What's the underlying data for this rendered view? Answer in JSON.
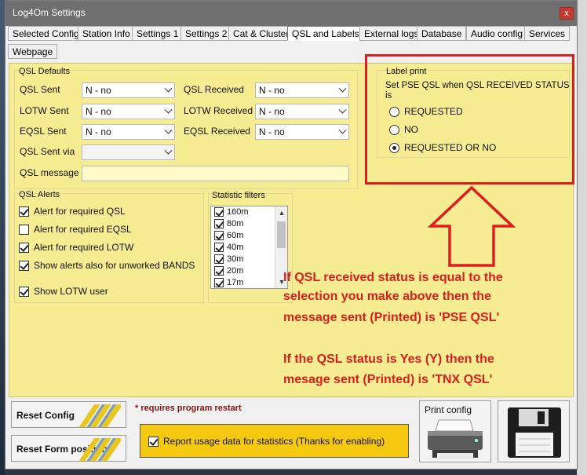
{
  "window": {
    "title": "Log4Om Settings",
    "close_glyph": "x"
  },
  "tabs": [
    {
      "label": "Selected Config"
    },
    {
      "label": "Station Info"
    },
    {
      "label": "Settings 1"
    },
    {
      "label": "Settings 2"
    },
    {
      "label": "Cat & Cluster"
    },
    {
      "label": "QSL and Labels",
      "active": true
    },
    {
      "label": "External logs"
    },
    {
      "label": "Database"
    },
    {
      "label": "Audio config"
    },
    {
      "label": "Services"
    },
    {
      "label": "Webpage"
    }
  ],
  "qsl_defaults": {
    "group_label": "QSL Defaults",
    "qsl_sent_label": "QSL Sent",
    "qsl_sent_value": "N - no",
    "qsl_received_label": "QSL Received",
    "qsl_received_value": "N - no",
    "lotw_sent_label": "LOTW Sent",
    "lotw_sent_value": "N - no",
    "lotw_received_label": "LOTW Received",
    "lotw_received_value": "N - no",
    "eqsl_sent_label": "EQSL Sent",
    "eqsl_sent_value": "N - no",
    "eqsl_received_label": "EQSL Received",
    "eqsl_received_value": "N - no",
    "qsl_sent_via_label": "QSL Sent via",
    "qsl_sent_via_value": "",
    "qsl_message_label": "QSL message",
    "qsl_message_value": ""
  },
  "label_print": {
    "group_label": "Label print",
    "description_line1": "Set PSE QSL when QSL RECEIVED STATUS",
    "description_line2": "is",
    "options": [
      {
        "label": "REQUESTED",
        "selected": false
      },
      {
        "label": "NO",
        "selected": false
      },
      {
        "label": "REQUESTED OR NO",
        "selected": true
      }
    ]
  },
  "qsl_alerts": {
    "group_label": "QSL Alerts",
    "items": [
      {
        "label": "Alert for required QSL",
        "checked": true
      },
      {
        "label": "Alert for required EQSL",
        "checked": false
      },
      {
        "label": "Alert for required LOTW",
        "checked": true
      },
      {
        "label": "Show alerts also for unworked BANDS",
        "checked": true
      },
      {
        "label": "Show LOTW user",
        "checked": true
      }
    ]
  },
  "statistic_filters": {
    "group_label": "Statistic filters",
    "bands": [
      {
        "label": "160m",
        "checked": true
      },
      {
        "label": "80m",
        "checked": true
      },
      {
        "label": "60m",
        "checked": true
      },
      {
        "label": "40m",
        "checked": true
      },
      {
        "label": "30m",
        "checked": true
      },
      {
        "label": "20m",
        "checked": true
      },
      {
        "label": "17m",
        "checked": true
      }
    ]
  },
  "annotation": {
    "lines": [
      "If QSL received status is equal to the",
      "selection you make above then the",
      "message sent (Printed) is 'PSE QSL'",
      "",
      "If the QSL status is Yes (Y) then the",
      "mesage sent (Printed) is 'TNX QSL'"
    ],
    "color": "#d81f1f"
  },
  "bottom": {
    "reset_config_label": "Reset Config",
    "reset_positions_label": "Reset Form positions",
    "restart_note": "* requires program restart",
    "usage_label": "Report usage data for statistics (Thanks for enabling)",
    "usage_checked": true,
    "print_config_label": "Print config"
  },
  "colors": {
    "panel": "#f6ec92",
    "accent_red": "#e11c1c",
    "usage_bg": "#f5c812"
  }
}
